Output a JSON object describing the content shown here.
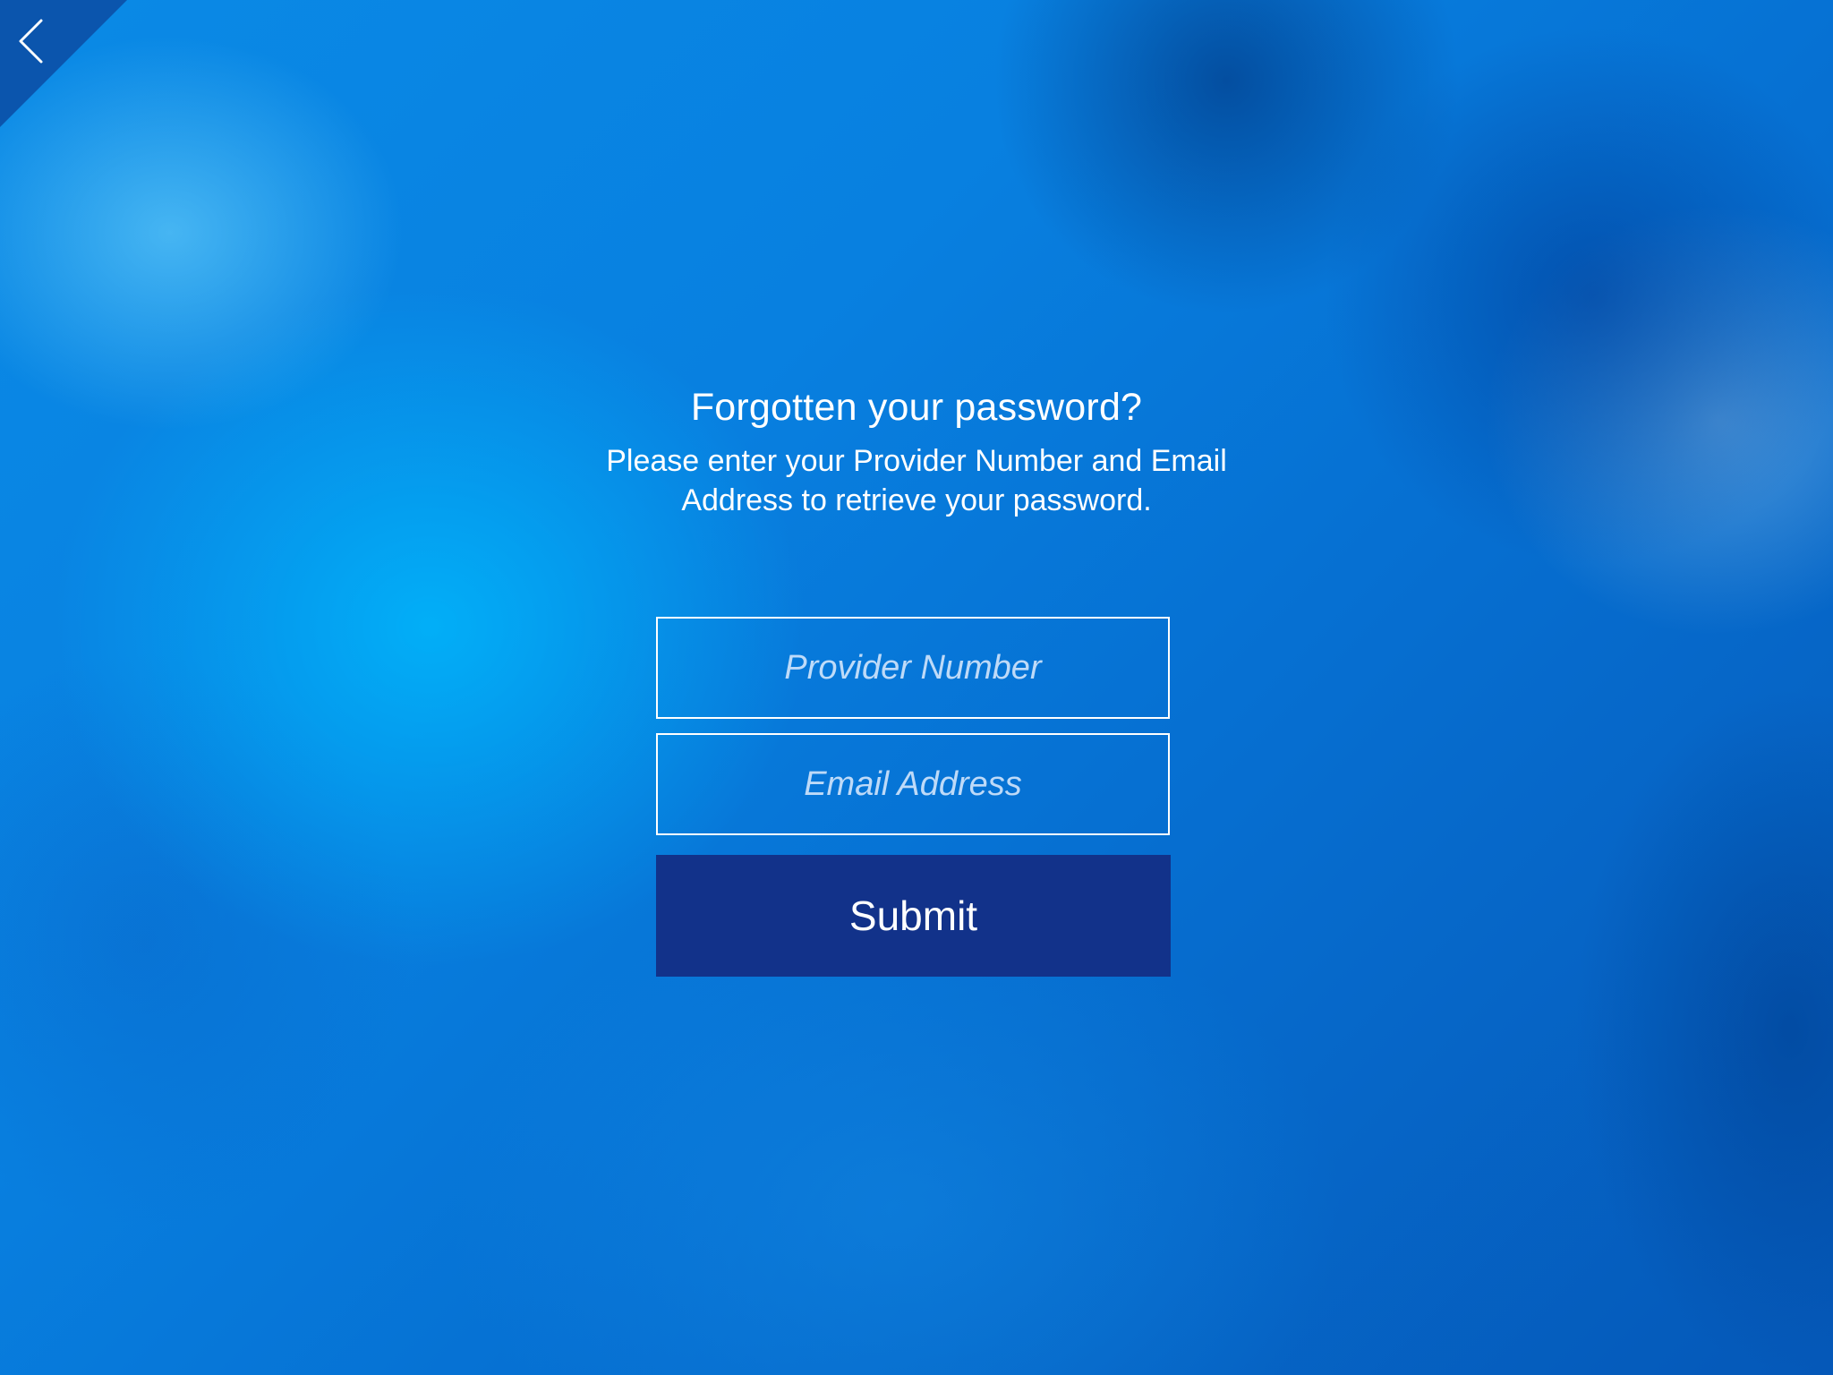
{
  "nav": {
    "back_icon": "chevron-left-icon"
  },
  "header": {
    "title": "Forgotten your password?",
    "subtitle": "Please enter your Provider Number and Email Address to retrieve your password."
  },
  "form": {
    "provider_number": {
      "value": "",
      "placeholder": "Provider Number"
    },
    "email_address": {
      "value": "",
      "placeholder": "Email Address"
    },
    "submit_label": "Submit"
  },
  "colors": {
    "background": "#0a6fd0",
    "back_corner": "#0b55ad",
    "submit_button": "#12328a",
    "text": "#ffffff"
  }
}
